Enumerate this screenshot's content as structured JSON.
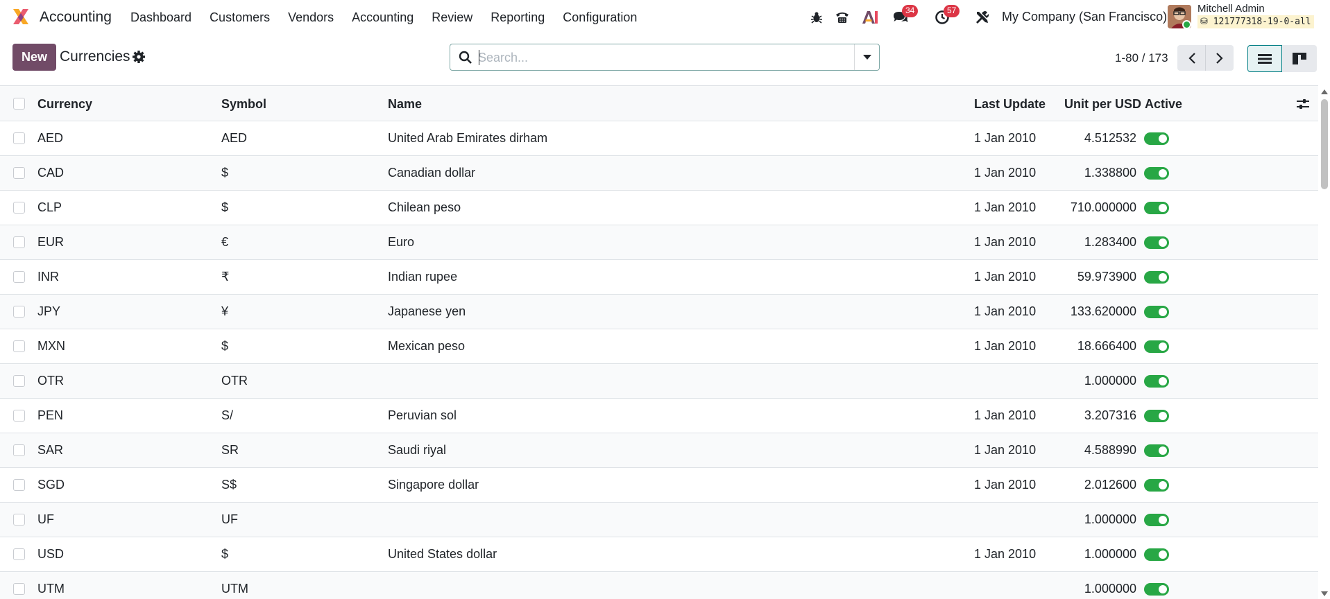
{
  "navbar": {
    "app_name": "Accounting",
    "menu": [
      "Dashboard",
      "Customers",
      "Vendors",
      "Accounting",
      "Review",
      "Reporting",
      "Configuration"
    ],
    "icons": [
      "bug-icon",
      "phone-icon",
      "ai-icon",
      "messages-icon",
      "activity-clock-icon",
      "tools-icon"
    ],
    "messages_count": "34",
    "activities_count": "57",
    "company": "My Company (San Francisco)",
    "user_name": "Mitchell Admin",
    "database": "121777318-19-0-all"
  },
  "control_panel": {
    "new_label": "New",
    "title": "Currencies",
    "search_placeholder": "Search...",
    "pager": "1-80 / 173"
  },
  "table": {
    "columns": {
      "currency": "Currency",
      "symbol": "Symbol",
      "name": "Name",
      "last_update": "Last Update",
      "unit_per_usd": "Unit per USD",
      "active": "Active"
    },
    "rows": [
      {
        "currency": "AED",
        "symbol": "AED",
        "name": "United Arab Emirates dirham",
        "last_update": "1 Jan 2010",
        "rate": "4.512532",
        "active": true
      },
      {
        "currency": "CAD",
        "symbol": "$",
        "name": "Canadian dollar",
        "last_update": "1 Jan 2010",
        "rate": "1.338800",
        "active": true
      },
      {
        "currency": "CLP",
        "symbol": "$",
        "name": "Chilean peso",
        "last_update": "1 Jan 2010",
        "rate": "710.000000",
        "active": true
      },
      {
        "currency": "EUR",
        "symbol": "€",
        "name": "Euro",
        "last_update": "1 Jan 2010",
        "rate": "1.283400",
        "active": true
      },
      {
        "currency": "INR",
        "symbol": "₹",
        "name": "Indian rupee",
        "last_update": "1 Jan 2010",
        "rate": "59.973900",
        "active": true
      },
      {
        "currency": "JPY",
        "symbol": "¥",
        "name": "Japanese yen",
        "last_update": "1 Jan 2010",
        "rate": "133.620000",
        "active": true
      },
      {
        "currency": "MXN",
        "symbol": "$",
        "name": "Mexican peso",
        "last_update": "1 Jan 2010",
        "rate": "18.666400",
        "active": true
      },
      {
        "currency": "OTR",
        "symbol": "OTR",
        "name": "",
        "last_update": "",
        "rate": "1.000000",
        "active": true
      },
      {
        "currency": "PEN",
        "symbol": "S/",
        "name": "Peruvian sol",
        "last_update": "1 Jan 2010",
        "rate": "3.207316",
        "active": true
      },
      {
        "currency": "SAR",
        "symbol": "SR",
        "name": "Saudi riyal",
        "last_update": "1 Jan 2010",
        "rate": "4.588990",
        "active": true
      },
      {
        "currency": "SGD",
        "symbol": "S$",
        "name": "Singapore dollar",
        "last_update": "1 Jan 2010",
        "rate": "2.012600",
        "active": true
      },
      {
        "currency": "UF",
        "symbol": "UF",
        "name": "",
        "last_update": "",
        "rate": "1.000000",
        "active": true
      },
      {
        "currency": "USD",
        "symbol": "$",
        "name": "United States dollar",
        "last_update": "1 Jan 2010",
        "rate": "1.000000",
        "active": true
      },
      {
        "currency": "UTM",
        "symbol": "UTM",
        "name": "",
        "last_update": "",
        "rate": "1.000000",
        "active": true
      }
    ]
  },
  "colors": {
    "brand": "#714b67",
    "toggle_on": "#28a745",
    "badge": "#dc3545",
    "focus": "#017e84"
  }
}
